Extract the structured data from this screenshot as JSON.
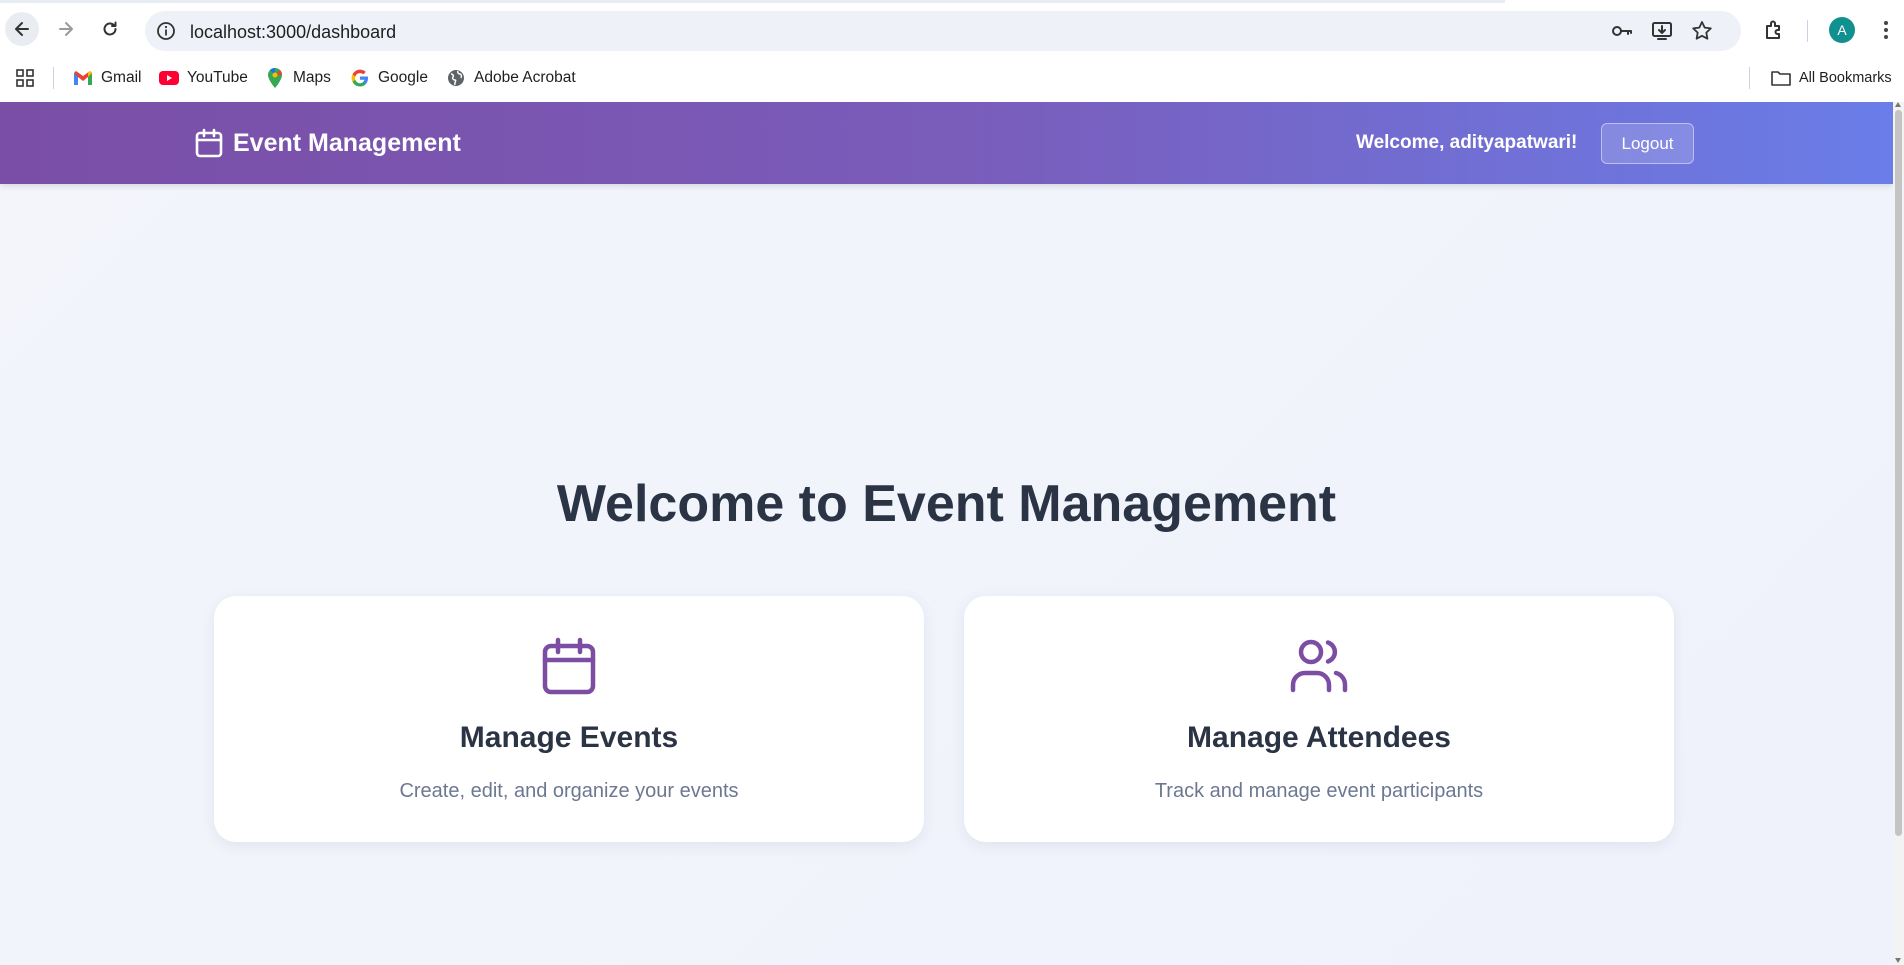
{
  "browser": {
    "url": "localhost:3000/dashboard",
    "profile_initial": "A",
    "bookmarks": [
      {
        "label": "Gmail",
        "icon": "gmail-icon"
      },
      {
        "label": "YouTube",
        "icon": "youtube-icon"
      },
      {
        "label": "Maps",
        "icon": "maps-icon"
      },
      {
        "label": "Google",
        "icon": "google-icon"
      },
      {
        "label": "Adobe Acrobat",
        "icon": "globe-icon"
      }
    ],
    "all_bookmarks_label": "All Bookmarks"
  },
  "app": {
    "brand": "Event Management",
    "welcome_text": "Welcome, adityapatwari!",
    "logout_label": "Logout",
    "hero_title": "Welcome to Event Management",
    "cards": [
      {
        "title": "Manage Events",
        "description": "Create, edit, and organize your events",
        "icon": "calendar-icon"
      },
      {
        "title": "Manage Attendees",
        "description": "Track and manage event participants",
        "icon": "users-icon"
      }
    ],
    "colors": {
      "header_start": "#7a4ea6",
      "header_end": "#6a7de8",
      "accent": "#7b4ea3",
      "heading": "#2b3445",
      "muted": "#6c7891"
    }
  }
}
